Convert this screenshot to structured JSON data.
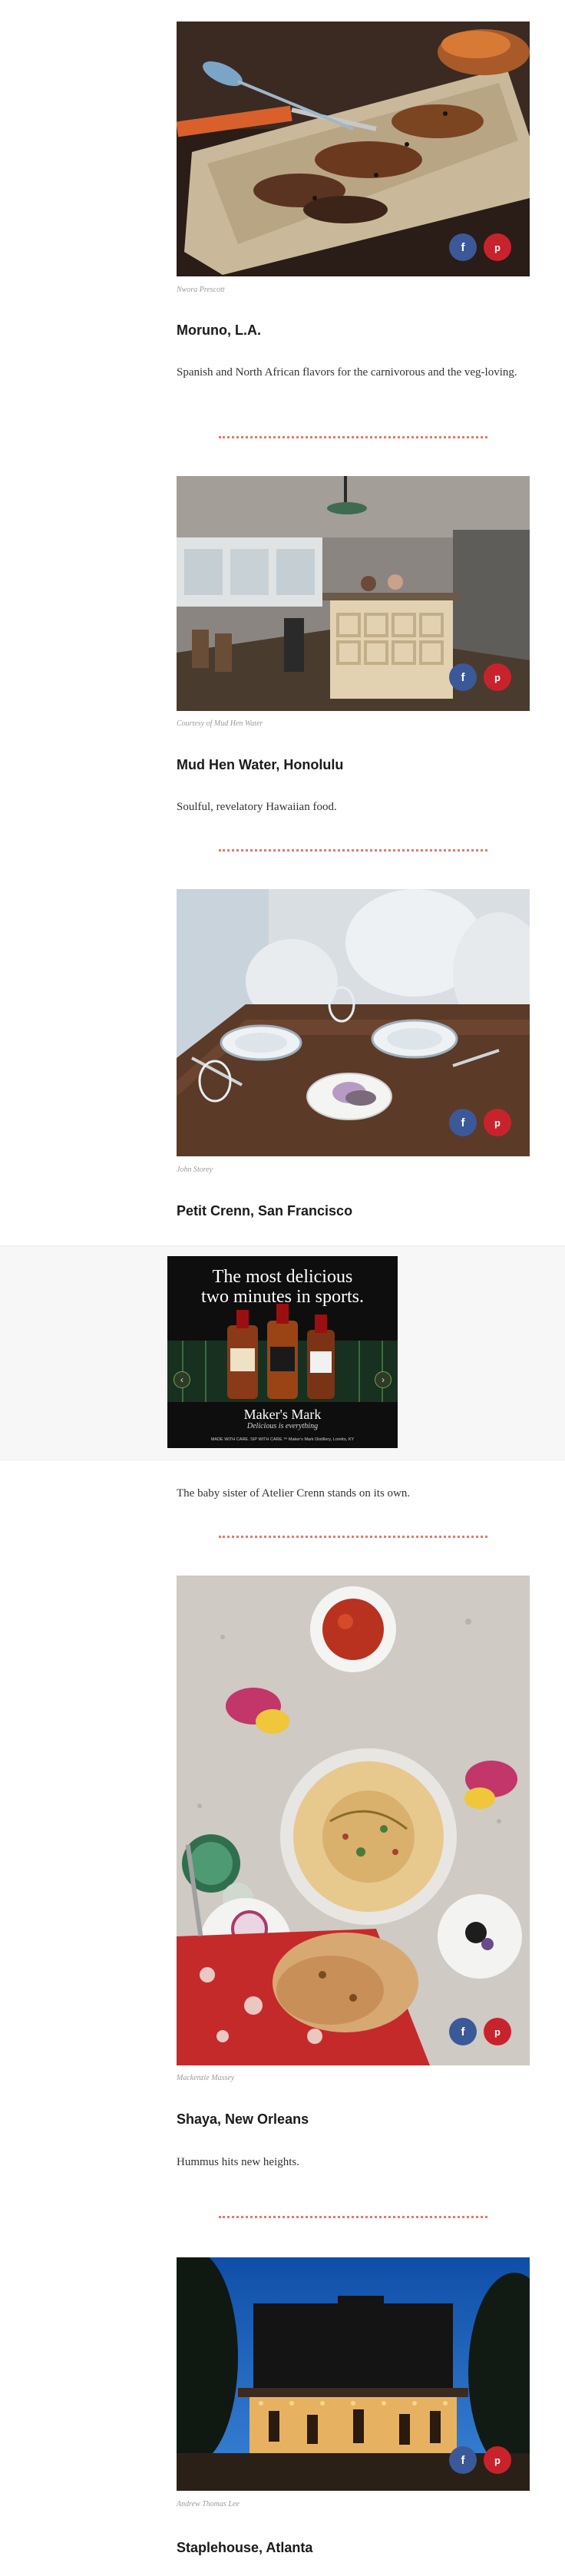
{
  "entries": [
    {
      "credit": "Nwora Prescott",
      "title": "Moruno, L.A.",
      "description": "Spanish and North African flavors for the carnivorous and the veg-loving.",
      "share": {
        "facebook": "f",
        "pinterest": "p"
      }
    },
    {
      "credit": "Courtesy of Mud Hen Water",
      "title": "Mud Hen Water, Honolulu",
      "description": "Soulful, revelatory Hawaiian food.",
      "share": {
        "facebook": "f",
        "pinterest": "p"
      }
    },
    {
      "credit": "John Storey",
      "title": "Petit Crenn, San Francisco",
      "description": "The baby sister of Atelier Crenn stands on its own.",
      "share": {
        "facebook": "f",
        "pinterest": "p"
      }
    },
    {
      "credit": "Mackenzie Massey",
      "title": "Shaya, New Orleans",
      "description": "Hummus hits new heights.",
      "share": {
        "facebook": "f",
        "pinterest": "p"
      }
    },
    {
      "credit": "Andrew Thomas Lee",
      "title": "Staplehouse, Atlanta",
      "share": {
        "facebook": "f",
        "pinterest": "p"
      }
    }
  ],
  "ad": {
    "headline_line1": "The most delicious",
    "headline_line2": "two minutes in sports.",
    "brand": "Maker's Mark",
    "tagline": "Delicious is everything",
    "fine_print": "MADE WITH CARE. SIP WITH CARE.™ Maker's Mark Distillery, Loretto, KY",
    "prev_arrow": "‹",
    "next_arrow": "›"
  },
  "colors": {
    "facebook": "#3b5998",
    "pinterest": "#c8232c",
    "divider": "#e9776a"
  }
}
